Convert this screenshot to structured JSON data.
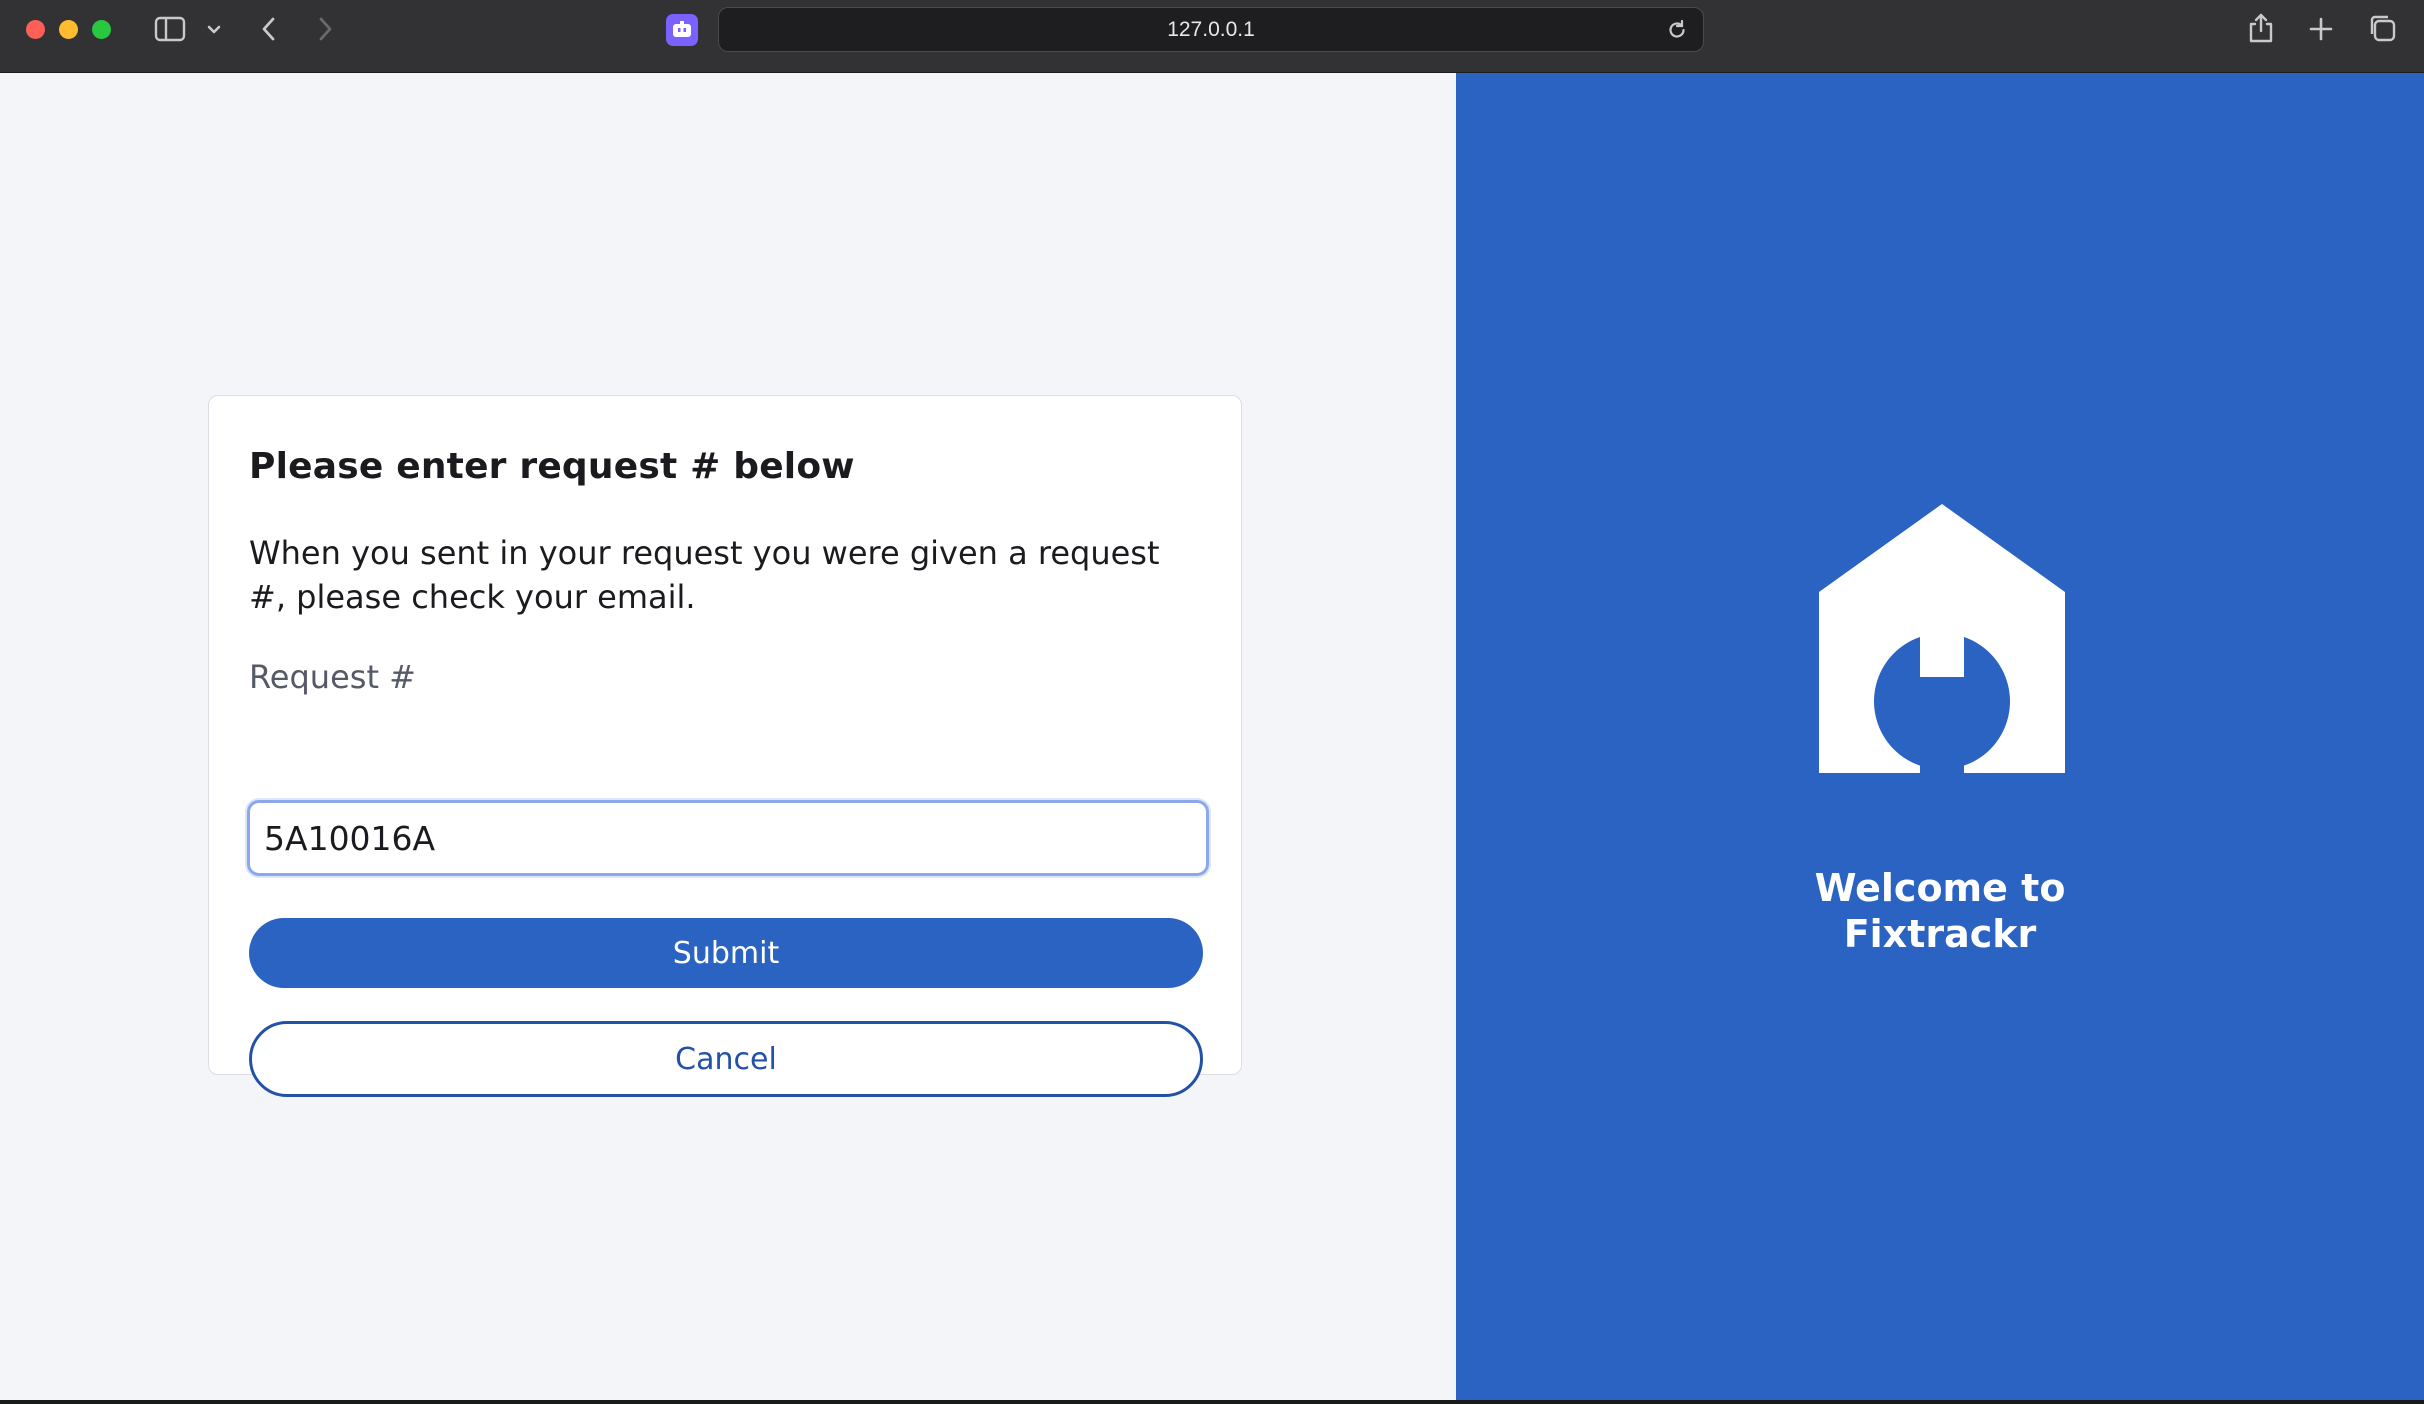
{
  "browser": {
    "url": "127.0.0.1",
    "colors": {
      "chrome": "#323234",
      "favicon": "#7b61ff"
    }
  },
  "form": {
    "title": "Please enter request # below",
    "description": "When you sent in your request you were given a request #, please check your email.",
    "field_label": "Request #",
    "request_value": "5A10016A",
    "submit_label": "Submit",
    "cancel_label": "Cancel"
  },
  "brand": {
    "welcome_line1": "Welcome to",
    "welcome_line2": "Fixtrackr",
    "logo_icon": "house-wrench-icon",
    "colors": {
      "primary": "#2b63c3",
      "panel_bg": "#f4f5f9"
    }
  }
}
